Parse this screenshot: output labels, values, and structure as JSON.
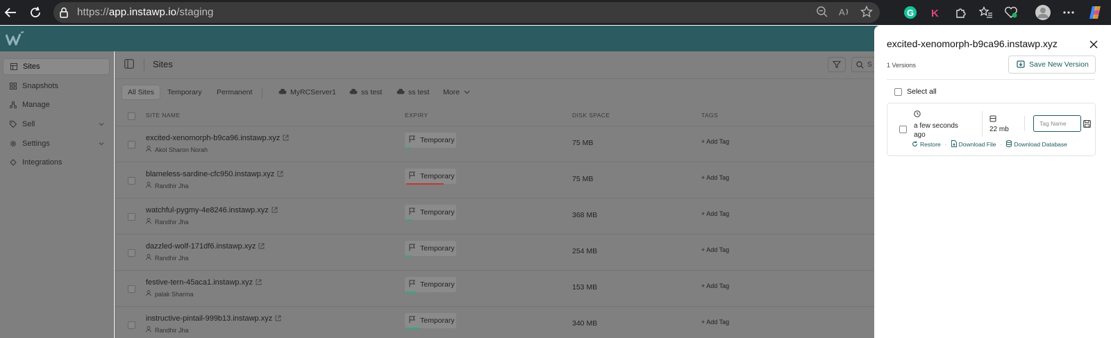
{
  "browser": {
    "url_scheme": "https://",
    "url_domain": "app.instawp.io",
    "url_path": "/staging"
  },
  "sidebar": {
    "items": [
      {
        "label": "Sites",
        "icon": "list-icon",
        "active": true
      },
      {
        "label": "Snapshots",
        "icon": "grid-icon"
      },
      {
        "label": "Manage",
        "icon": "share-icon"
      },
      {
        "label": "Sell",
        "icon": "tag-icon",
        "has_chevron": true
      },
      {
        "label": "Settings",
        "icon": "gear-icon",
        "has_chevron": true
      },
      {
        "label": "Integrations",
        "icon": "plug-icon"
      }
    ]
  },
  "main": {
    "title": "Sites",
    "search_placeholder": "S",
    "tabs": [
      {
        "label": "All Sites",
        "active": true
      },
      {
        "label": "Temporary"
      },
      {
        "label": "Permanent"
      },
      {
        "label": "MyRCServer1",
        "cloud": true
      },
      {
        "label": "ss test",
        "cloud": true
      },
      {
        "label": "ss test",
        "cloud": true
      },
      {
        "label": "More",
        "chevron": true
      }
    ],
    "columns": [
      "SITE NAME",
      "EXPIRY",
      "DISK SPACE",
      "TAGS"
    ],
    "rows": [
      {
        "site": "excited-xenomorph-b9ca96.instawp.xyz",
        "owner": "Akol Sharon Norah",
        "expiry": "Temporary",
        "bar_color": "#2fa88a",
        "disk": "75 MB",
        "tag": "+ Add Tag"
      },
      {
        "site": "blameless-sardine-cfc950.instawp.xyz",
        "owner": "Randhir Jha",
        "expiry": "Temporary",
        "bar_color": "#c0392b",
        "disk": "75 MB",
        "tag": "+ Add Tag"
      },
      {
        "site": "watchful-pygmy-4e8246.instawp.xyz",
        "owner": "Randhir Jha",
        "expiry": "Temporary",
        "bar_color": "#2fa88a",
        "disk": "368 MB",
        "tag": "+ Add Tag"
      },
      {
        "site": "dazzled-wolf-171df6.instawp.xyz",
        "owner": "Randhir Jha",
        "expiry": "Temporary",
        "bar_color": "#2fa88a",
        "disk": "254 MB",
        "tag": "+ Add Tag"
      },
      {
        "site": "festive-tern-45aca1.instawp.xyz",
        "owner": "palak Sharma",
        "expiry": "Temporary",
        "bar_color": "#2fa88a",
        "disk": "153 MB",
        "tag": "+ Add Tag"
      },
      {
        "site": "instructive-pintail-999b13.instawp.xyz",
        "owner": "Randhir Jha",
        "expiry": "Temporary",
        "bar_color": "#2fa88a",
        "disk": "340 MB",
        "tag": "+ Add Tag"
      }
    ]
  },
  "panel": {
    "title": "excited-xenomorph-b9ca96.instawp.xyz",
    "versions_count": "1 Versions",
    "save_button": "Save New Version",
    "select_all": "Select all",
    "version": {
      "time": "a few seconds ago",
      "size": "22 mb",
      "tag_placeholder": "Tag Name",
      "actions": [
        "Restore",
        "Download File",
        "Download Database"
      ]
    }
  },
  "colors": {
    "accent": "#1d5a60",
    "header": "#2c5b62",
    "overlay_gray": "#808080"
  }
}
